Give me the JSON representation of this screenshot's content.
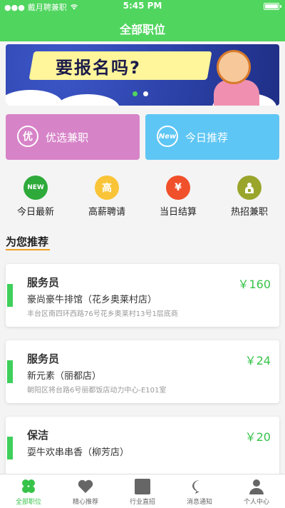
{
  "status_bar": {
    "carrier": "戴月聘兼职",
    "time": "5:45 PM"
  },
  "nav": {
    "title": "全部职位"
  },
  "banner": {
    "text": "要报名吗?",
    "slide_count": 2,
    "active_slide": 0
  },
  "promo_tiles": [
    {
      "icon_char": "优",
      "label": "优选兼职",
      "color": "#d783c8"
    },
    {
      "icon_char": "New",
      "label": "今日推荐",
      "color": "#5ec6f4"
    }
  ],
  "categories": [
    {
      "icon_text": "NEW",
      "label": "今日最新",
      "color": "#2eaa3b"
    },
    {
      "icon_text": "高",
      "label": "高薪聘请",
      "color": "#f9c437"
    },
    {
      "icon_text": "¥",
      "label": "当日结算",
      "color": "#f0502a"
    },
    {
      "icon_text": "",
      "label": "热招兼职",
      "color": "#9aa52c"
    }
  ],
  "section": {
    "title": "为您推荐"
  },
  "jobs": [
    {
      "title": "服务员",
      "price": "￥160",
      "company": "豪尚豪牛排馆（花乡奥莱村店）",
      "address": "丰台区南四环西路76号花乡奥莱村13号1层底商"
    },
    {
      "title": "服务员",
      "price": "￥24",
      "company": "新元素（丽都店）",
      "address": "朝阳区将台路6号丽都饭店动力中心-E101室"
    },
    {
      "title": "保洁",
      "price": "￥20",
      "company": "耍牛欢串串香（柳芳店）",
      "address": ""
    }
  ],
  "tabbar": [
    {
      "label": "全部职位",
      "icon": "clover-icon",
      "active": true
    },
    {
      "label": "精心推荐",
      "icon": "heart-icon",
      "active": false
    },
    {
      "label": "行业直招",
      "icon": "square-icon",
      "active": false
    },
    {
      "label": "消息通知",
      "icon": "chat-icon",
      "active": false
    },
    {
      "label": "个人中心",
      "icon": "person-icon",
      "active": false
    }
  ],
  "colors": {
    "brand_green": "#50d55e",
    "price_green": "#37c349",
    "accent_orange": "#f0a020"
  }
}
